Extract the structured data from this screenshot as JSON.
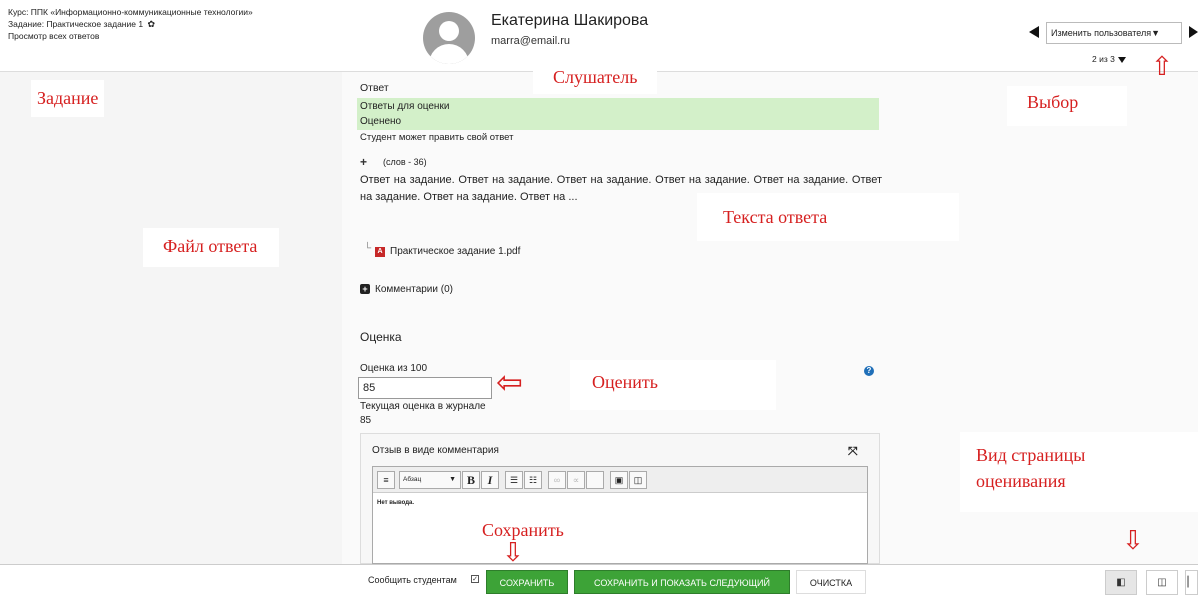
{
  "header": {
    "course": "Курс: ППК «Информационно-коммуникационные технологии»",
    "assignment": "Задание: Практическое задание 1",
    "view_all": "Просмотр всех ответов",
    "student_name": "Екатерина Шакирова",
    "student_email": "marra@email.ru",
    "change_user_label": "Изменить пользователя",
    "caret": "▼",
    "counter": "2 из 3"
  },
  "annotations": {
    "task": "Задание",
    "listener": "Слушатель",
    "choice": "Выбор",
    "answer_file": "Файл ответа",
    "answer_text": "Текста ответа",
    "grade": "Оценить",
    "save": "Сохранить",
    "page_view_line1": "Вид страницы",
    "page_view_line2": "оценивания"
  },
  "submission": {
    "heading": "Ответ",
    "status_1": "Ответы для оценки",
    "status_2": "Оценено",
    "status_3": "Студент может править свой ответ",
    "word_count": "(слов - 36)",
    "text": "Ответ на задание. Ответ на задание. Ответ на задание. Ответ на задание. Ответ на задание. Ответ на задание. Ответ на задание. Ответ на ...",
    "file_name": "Практическое задание 1.pdf",
    "comments": "Комментарии (0)"
  },
  "grade": {
    "heading": "Оценка",
    "out_of_label": "Оценка из 100",
    "value": "85",
    "current_label": "Текущая оценка в журнале",
    "current_value": "85"
  },
  "feedback": {
    "title": "Отзыв в виде комментария",
    "paragraph_format": "Абзац",
    "bold": "B",
    "italic": "I",
    "body": "Нет вывода."
  },
  "footer": {
    "notify_label": "Сообщить студентам",
    "save": "СОХРАНИТЬ",
    "save_next": "СОХРАНИТЬ И ПОКАЗАТЬ СЛЕДУЮЩИЙ",
    "reset": "ОЧИСТКА"
  },
  "colors": {
    "annotation_red": "#d62020",
    "save_green": "#3da337",
    "status_green": "#d3f0c9"
  }
}
